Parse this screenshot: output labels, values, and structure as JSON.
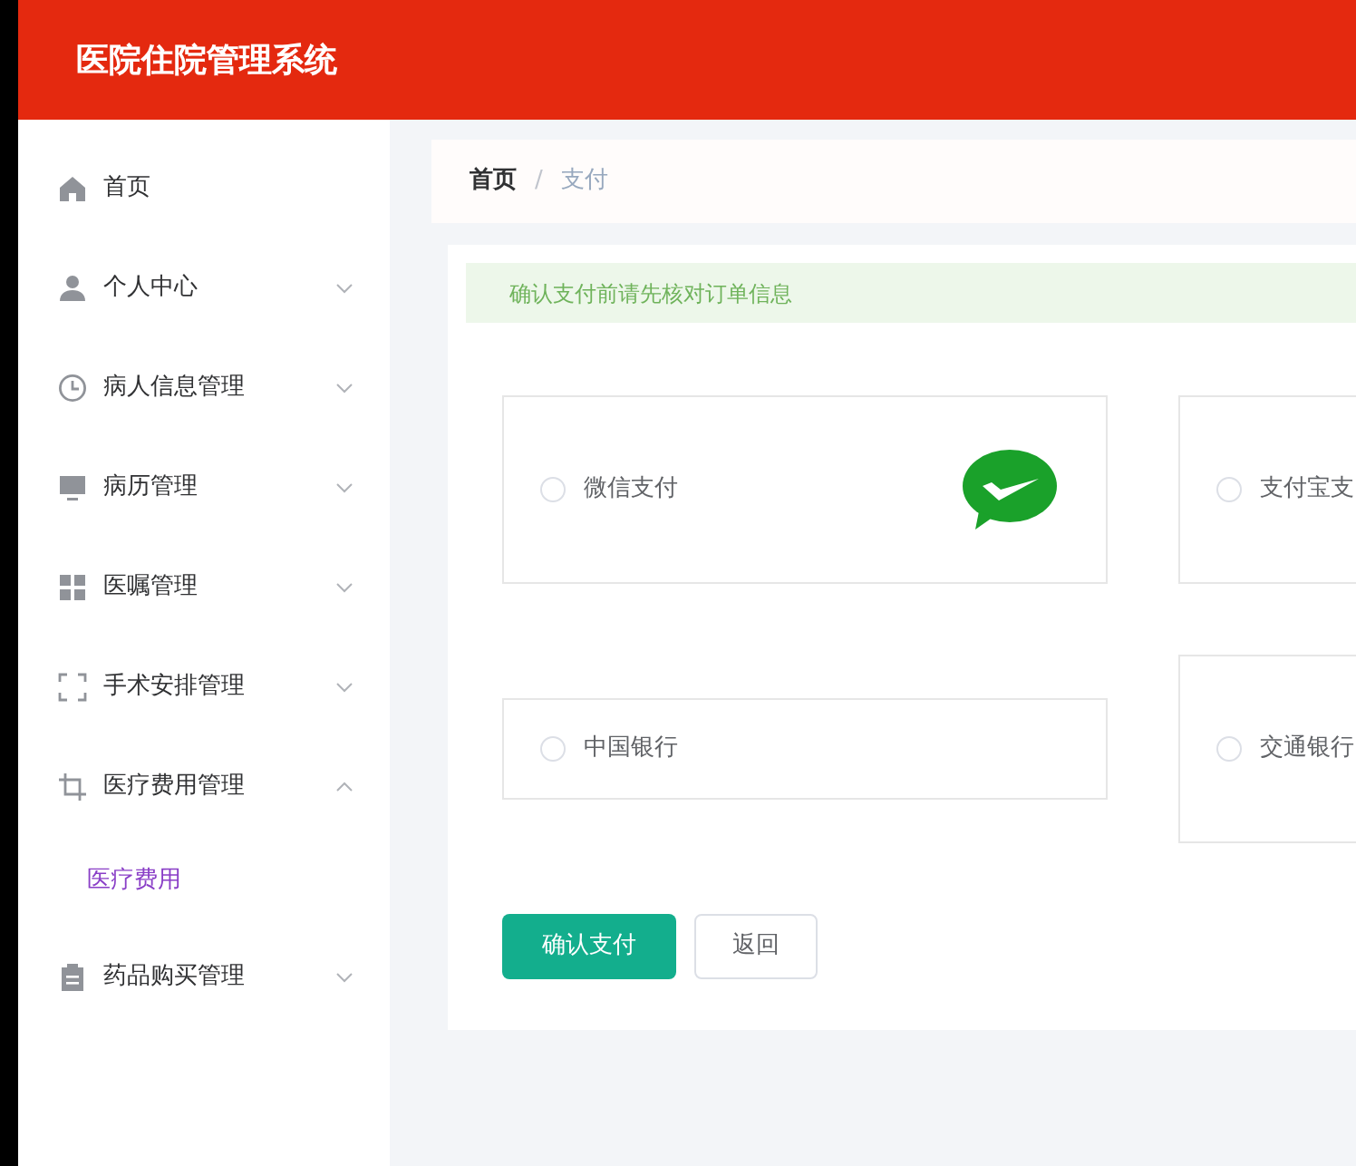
{
  "header": {
    "title": "医院住院管理系统"
  },
  "sidebar": {
    "items": [
      {
        "label": "首页"
      },
      {
        "label": "个人中心",
        "expanded": false
      },
      {
        "label": "病人信息管理",
        "expanded": false
      },
      {
        "label": "病历管理",
        "expanded": false
      },
      {
        "label": "医嘱管理",
        "expanded": false
      },
      {
        "label": "手术安排管理",
        "expanded": false
      },
      {
        "label": "医疗费用管理",
        "expanded": true,
        "children": [
          {
            "label": "医疗费用",
            "selected": true
          }
        ]
      },
      {
        "label": "药品购买管理",
        "expanded": false
      }
    ]
  },
  "breadcrumb": [
    {
      "label": "首页",
      "current": false
    },
    {
      "label": "支付",
      "current": true
    }
  ],
  "breadcrumb_separator": "/",
  "alert": "确认支付前请先核对订单信息",
  "payment_options": [
    {
      "label": "微信支付",
      "selected": false
    },
    {
      "label": "支付宝支",
      "selected": false
    },
    {
      "label": "中国银行",
      "selected": false
    },
    {
      "label": "交通银行",
      "selected": false
    }
  ],
  "buttons": [
    {
      "label": "确认支付",
      "kind": "primary"
    },
    {
      "label": "返回",
      "kind": "default"
    }
  ]
}
